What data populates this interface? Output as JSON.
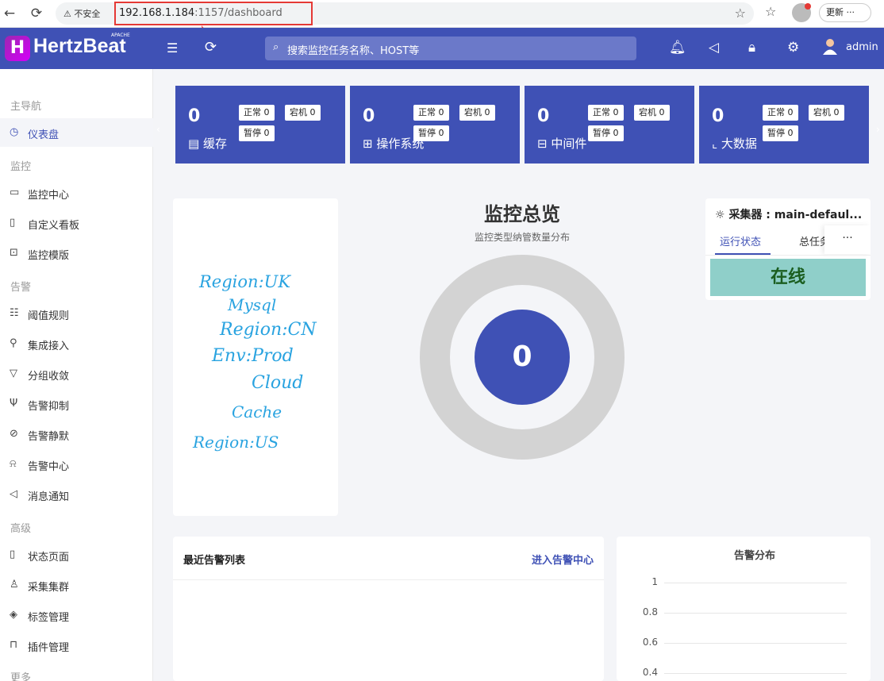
{
  "browser": {
    "security_label": "不安全",
    "url_host": "192.168.1.184",
    "url_rest": ":1157/dashboard",
    "update_label": "更新"
  },
  "header": {
    "logo_text": "HertzBeat",
    "logo_badge": "APACHE",
    "search_placeholder": "搜索监控任务名称、HOST等",
    "user": "admin"
  },
  "sidebar": {
    "groups": [
      {
        "label": "主导航",
        "items": [
          {
            "label": "仪表盘",
            "icon": "dashboard-icon",
            "active": true
          }
        ]
      },
      {
        "label": "监控",
        "items": [
          {
            "label": "监控中心",
            "icon": "monitor-icon"
          },
          {
            "label": "自定义看板",
            "icon": "board-icon"
          },
          {
            "label": "监控模版",
            "icon": "template-icon"
          }
        ]
      },
      {
        "label": "告警",
        "items": [
          {
            "label": "阈值规则",
            "icon": "rule-icon"
          },
          {
            "label": "集成接入",
            "icon": "integration-icon"
          },
          {
            "label": "分组收敛",
            "icon": "filter-icon"
          },
          {
            "label": "告警抑制",
            "icon": "inhibit-icon"
          },
          {
            "label": "告警静默",
            "icon": "mute-icon"
          },
          {
            "label": "告警中心",
            "icon": "alarm-icon"
          },
          {
            "label": "消息通知",
            "icon": "notice-icon"
          }
        ]
      },
      {
        "label": "高级",
        "items": [
          {
            "label": "状态页面",
            "icon": "status-page-icon"
          },
          {
            "label": "采集集群",
            "icon": "cluster-icon"
          },
          {
            "label": "标签管理",
            "icon": "tag-icon"
          },
          {
            "label": "插件管理",
            "icon": "plugin-icon"
          }
        ]
      },
      {
        "label": "更多",
        "items": []
      }
    ]
  },
  "stat_cards": [
    {
      "count": "0",
      "name": "缓存",
      "icon": "cache-icon",
      "normal": "正常 0",
      "down": "宕机 0",
      "paused": "暂停 0"
    },
    {
      "count": "0",
      "name": "操作系统",
      "icon": "os-icon",
      "normal": "正常 0",
      "down": "宕机 0",
      "paused": "暂停 0"
    },
    {
      "count": "0",
      "name": "中间件",
      "icon": "middleware-icon",
      "normal": "正常 0",
      "down": "宕机 0",
      "paused": "暂停 0"
    },
    {
      "count": "0",
      "name": "大数据",
      "icon": "bigdata-icon",
      "normal": "正常 0",
      "down": "宕机 0",
      "paused": "暂停 0"
    }
  ],
  "tag_cloud": [
    "Region:UK",
    "Mysql",
    "Region:CN",
    "Env:Prod",
    "Cloud",
    "Cache",
    "Region:US"
  ],
  "overview": {
    "title": "监控总览",
    "subtitle": "监控类型纳管数量分布",
    "total": "0"
  },
  "collector": {
    "title": "采集器 : main-defaul...",
    "tab_status": "运行状态",
    "tab_total": "总任务",
    "more": "···",
    "status": "在线"
  },
  "alerts": {
    "title": "最近告警列表",
    "link": "进入告警中心"
  },
  "chart_data": {
    "type": "bar",
    "title": "告警分布",
    "categories": [],
    "values": [],
    "y_ticks": [
      "1",
      "0.8",
      "0.6",
      "0.4"
    ],
    "ylim": [
      0,
      1
    ],
    "grid": true
  },
  "colors": {
    "primary": "#3f51b5",
    "online": "#8fcfc9",
    "tag": "#29a3e0"
  }
}
